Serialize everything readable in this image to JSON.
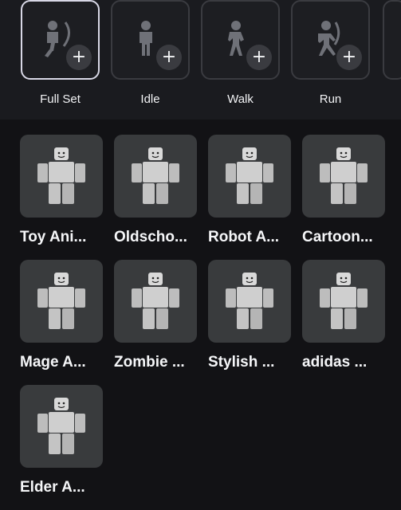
{
  "slots": [
    {
      "label": "Full Set",
      "icon": "person-swing-icon",
      "selected": true
    },
    {
      "label": "Idle",
      "icon": "person-standing-icon",
      "selected": false
    },
    {
      "label": "Walk",
      "icon": "person-walking-icon",
      "selected": false
    },
    {
      "label": "Run",
      "icon": "person-running-icon",
      "selected": false
    }
  ],
  "plus_symbol": "+",
  "packs": [
    {
      "label": "Toy Ani..."
    },
    {
      "label": "Oldscho..."
    },
    {
      "label": "Robot A..."
    },
    {
      "label": "Cartoon..."
    },
    {
      "label": "Mage A..."
    },
    {
      "label": "Zombie ..."
    },
    {
      "label": "Stylish ..."
    },
    {
      "label": "adidas ..."
    },
    {
      "label": "Elder A..."
    }
  ],
  "colors": {
    "background": "#121215",
    "card": "#393b3d",
    "selected_border": "#d8d8e6",
    "text": "#f2f3f5"
  }
}
